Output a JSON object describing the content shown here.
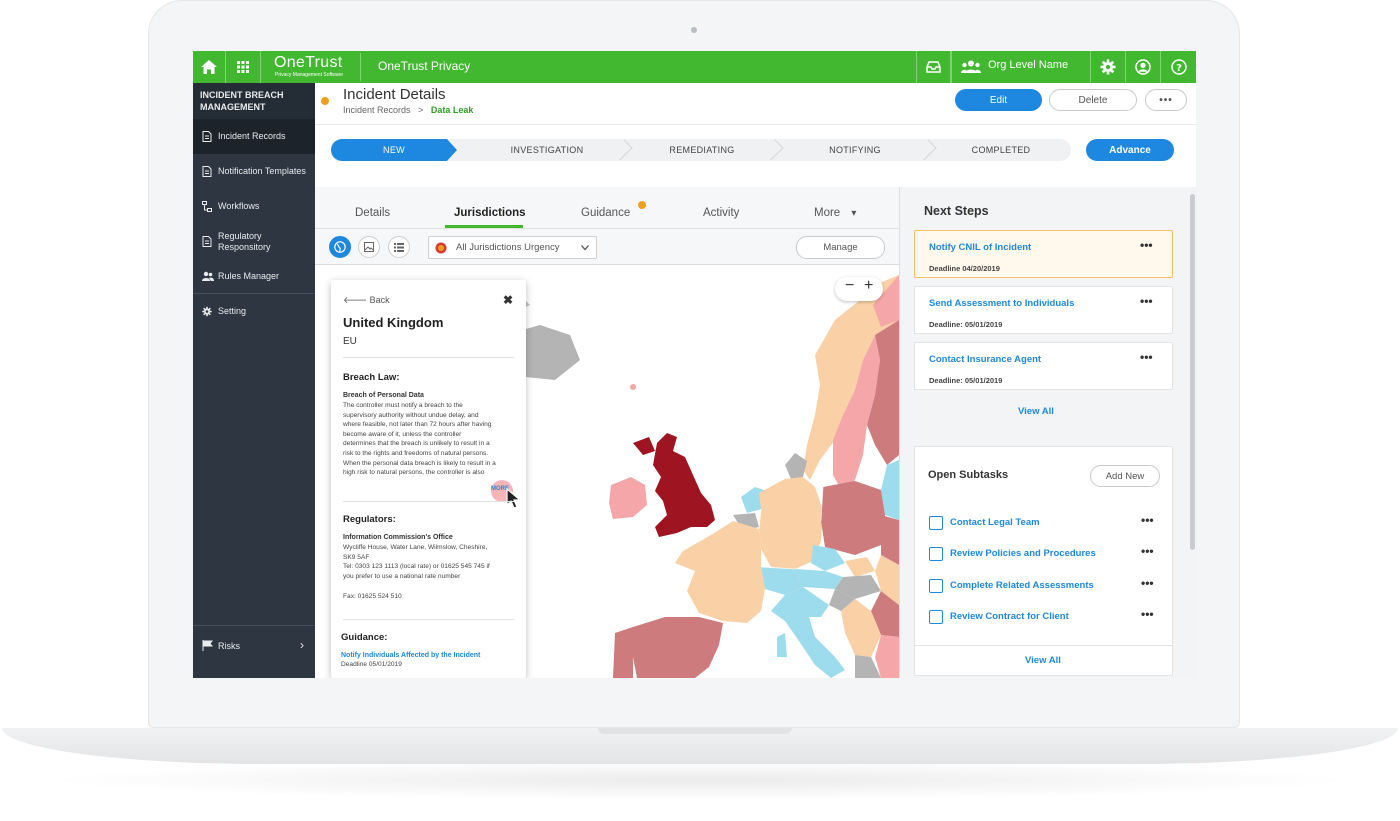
{
  "topbar": {
    "brand_name": "OneTrust",
    "brand_sub": "Privacy Management Software",
    "app_title": "OneTrust Privacy",
    "org_name": "Org Level Name"
  },
  "sidebar": {
    "title_line1": "INCIDENT BREACH",
    "title_line2": "MANAGEMENT",
    "items": [
      {
        "label": "Incident Records",
        "icon": "document-icon"
      },
      {
        "label": "Notification Templates",
        "icon": "document-icon"
      },
      {
        "label": "Workflows",
        "icon": "workflow-icon"
      },
      {
        "label_line1": "Regulatory",
        "label_line2": "Responsitory",
        "icon": "document-icon"
      },
      {
        "label": "Rules Manager",
        "icon": "users-icon"
      },
      {
        "label": "Setting",
        "icon": "gear-icon"
      }
    ],
    "bottom": {
      "label": "Risks",
      "icon": "flag-icon"
    }
  },
  "header": {
    "title": "Incident Details",
    "crumb_parent": "Incident Records",
    "crumb_sep": ">",
    "crumb_current": "Data Leak",
    "edit_label": "Edit",
    "delete_label": "Delete",
    "more_label": "•••"
  },
  "stepper": {
    "steps": [
      "NEW",
      "INVESTIGATION",
      "REMEDIATING",
      "NOTIFYING",
      "COMPLETED"
    ],
    "active_index": 0,
    "advance_label": "Advance"
  },
  "tabs": {
    "items": [
      "Details",
      "Jurisdictions",
      "Guidance",
      "Activity",
      "More"
    ],
    "active": "Jurisdictions",
    "more_caret": "▾"
  },
  "toolbar": {
    "select_value": "All Jurisdictions Urgency",
    "manage_label": "Manage"
  },
  "map": {
    "zoom_out": "−",
    "zoom_in": "+",
    "colors": {
      "critical": "#9e1420",
      "high": "#cd7b7d",
      "medium": "#f5a6a8",
      "low": "#fad1a6",
      "info": "#9ddcec",
      "none": "#b4b4b4"
    }
  },
  "popup": {
    "back_label": "Back",
    "close_label": "✖",
    "country": "United Kingdom",
    "region": "EU",
    "breach_law_heading": "Breach Law:",
    "breach_law_sub": "Breach of Personal Data",
    "breach_law_lines": [
      "The controller must notify a breach to the",
      "supervisory authority without undue delay, and",
      "where feasible, not later than 72 hours after having",
      "become aware of it, unless the controller",
      "determines that the breach is unlikely to result in a",
      "risk to the rights and freedoms of natural persons.",
      "When the personal data breach is likely to result in a",
      "high risk to natural persons, the controller is also"
    ],
    "more_label": "MORE",
    "regulators_heading": "Regulators:",
    "regulator_name": "Information Commission's Office",
    "regulator_lines": [
      "Wycliffe House, Water Lane, Wilmslow, Cheshire,",
      "SK9 5AF",
      "Tel: 0303 123 1113 (local rate) or 01625 545 745 if",
      "you prefer to use a national rate number"
    ],
    "fax": "Fax: 01625 524 510",
    "guidance_heading": "Guidance:",
    "guidance_link": "Notify Individuals Affected by the Incident",
    "guidance_deadline": "Deadline 05/01/2019"
  },
  "next_steps": {
    "title": "Next Steps",
    "items": [
      {
        "title": "Notify CNIL of Incident",
        "deadline": "Deadline 04/20/2019"
      },
      {
        "title": "Send Assessment to Individuals",
        "deadline": "Deadline: 05/01/2019"
      },
      {
        "title": "Contact Insurance Agent",
        "deadline": "Deadline: 05/01/2019"
      }
    ],
    "view_all": "View All"
  },
  "subtasks": {
    "title": "Open Subtasks",
    "add_label": "Add New",
    "items": [
      "Contact Legal Team",
      "Review Policies and Procedures",
      "Complete Related Assessments",
      "Review Contract for Client"
    ],
    "view_all": "View All"
  },
  "accent": {
    "green": "#41b82f",
    "blue": "#1e88e0",
    "sidebar": "#2d3641",
    "warning": "#f0a020"
  }
}
